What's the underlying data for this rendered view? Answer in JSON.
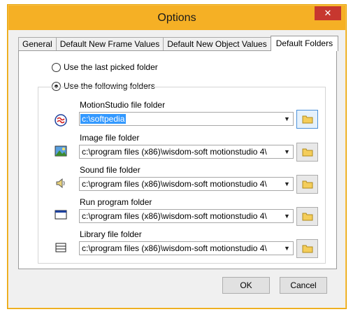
{
  "window": {
    "title": "Options",
    "close_glyph": "✕"
  },
  "tabs": [
    {
      "label": "General"
    },
    {
      "label": "Default New Frame Values"
    },
    {
      "label": "Default New Object Values"
    },
    {
      "label": "Default Folders",
      "active": true
    }
  ],
  "options": {
    "last_picked": "Use the last picked folder",
    "following": "Use the following folders",
    "selected": "following"
  },
  "folders": [
    {
      "label": "MotionStudio file folder",
      "value": "c:\\softpedia",
      "icon": "motionstudio-icon"
    },
    {
      "label": "Image file folder",
      "value": "c:\\program files (x86)\\wisdom-soft motionstudio 4\\",
      "icon": "image-icon"
    },
    {
      "label": "Sound file folder",
      "value": "c:\\program files (x86)\\wisdom-soft motionstudio 4\\",
      "icon": "speaker-icon"
    },
    {
      "label": "Run program folder",
      "value": "c:\\program files (x86)\\wisdom-soft motionstudio 4\\",
      "icon": "program-window-icon"
    },
    {
      "label": "Library file folder",
      "value": "c:\\program files (x86)\\wisdom-soft motionstudio 4\\",
      "icon": "library-icon"
    }
  ],
  "buttons": {
    "ok": "OK",
    "cancel": "Cancel"
  },
  "colors": {
    "titlebar": "#f5b025",
    "close": "#c7372f",
    "selection": "#3399ff"
  }
}
